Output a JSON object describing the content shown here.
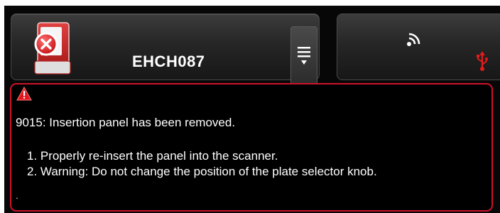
{
  "device": {
    "name": "EHCH087",
    "status_icon": "scanner-error-icon"
  },
  "toolbar": {
    "menu_icon": "menu-list-icon"
  },
  "connection": {
    "wifi_icon": "wifi-icon",
    "usb_icon": "usb-icon"
  },
  "error": {
    "icon": "warning-icon",
    "title": "9015: Insertion panel has been removed.",
    "steps": [
      "1. Properly re-insert the panel into the scanner.",
      "2. Warning: Do not change the position of the plate selector knob."
    ],
    "trailer": "."
  },
  "colors": {
    "alert_red": "#d0102a",
    "panel_bg": "#000000",
    "card_bg": "#262626"
  }
}
